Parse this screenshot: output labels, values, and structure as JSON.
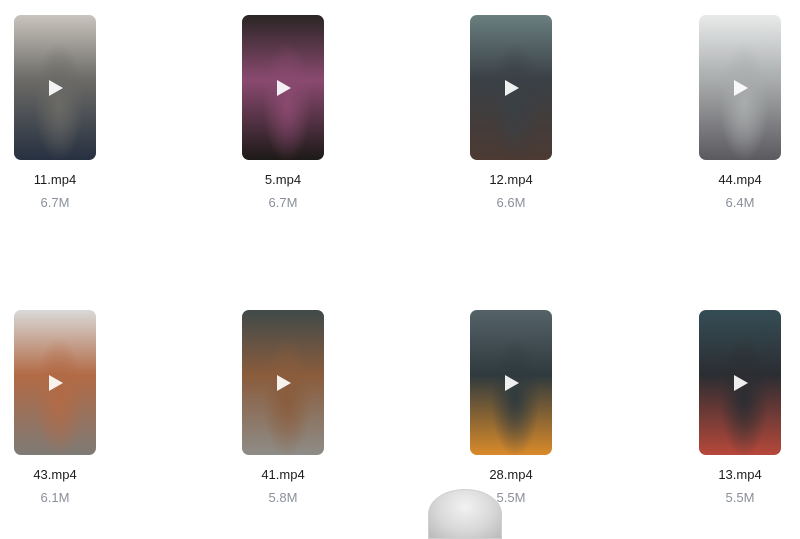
{
  "play_icon": "play-icon",
  "videos": [
    {
      "name": "11.mp4",
      "size": "6.7M",
      "colors": [
        "#c9c4bd",
        "#6b6a66",
        "#263040"
      ]
    },
    {
      "name": "5.mp4",
      "size": "6.7M",
      "colors": [
        "#2a2524",
        "#8a4a70",
        "#1d1a18"
      ]
    },
    {
      "name": "12.mp4",
      "size": "6.6M",
      "colors": [
        "#6a7f7f",
        "#3a4045",
        "#4c3a33"
      ]
    },
    {
      "name": "44.mp4",
      "size": "6.4M",
      "colors": [
        "#e8eaea",
        "#a9acad",
        "#5b5a5f"
      ]
    },
    {
      "name": "43.mp4",
      "size": "6.1M",
      "colors": [
        "#d9d9d8",
        "#b26a45",
        "#7e7a75"
      ]
    },
    {
      "name": "41.mp4",
      "size": "5.8M",
      "colors": [
        "#404a4a",
        "#8a5c3c",
        "#8e8c87"
      ]
    },
    {
      "name": "28.mp4",
      "size": "5.5M",
      "colors": [
        "#556268",
        "#2f3a3e",
        "#d98a2a"
      ]
    },
    {
      "name": "13.mp4",
      "size": "5.5M",
      "colors": [
        "#354d55",
        "#2b2d32",
        "#b6483a"
      ]
    }
  ]
}
